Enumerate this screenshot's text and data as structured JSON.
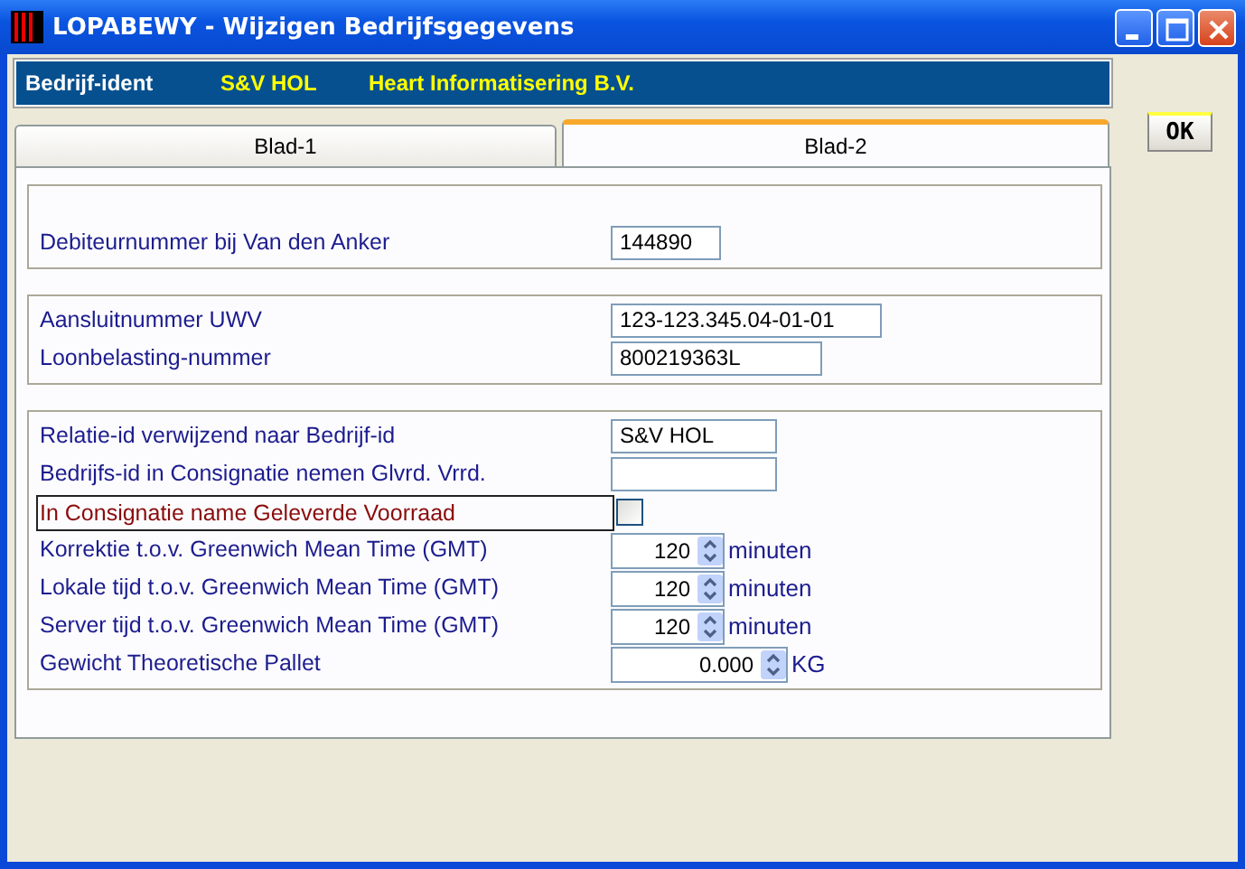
{
  "window": {
    "title": "LOPABEWY - Wijzigen Bedrijfsgegevens"
  },
  "header": {
    "label": "Bedrijf-ident",
    "code": "S&V HOL",
    "name": "Heart Informatisering B.V."
  },
  "tabs": [
    {
      "label": "Blad-1",
      "selected": false
    },
    {
      "label": "Blad-2",
      "selected": true
    }
  ],
  "ok_button": "OK",
  "groups": [
    {
      "rows": [
        {
          "kind": "blank"
        },
        {
          "kind": "text",
          "label": "Debiteurnummer bij Van den Anker",
          "value": "144890"
        }
      ]
    },
    {
      "rows": [
        {
          "kind": "text",
          "label": "Aansluitnummer UWV",
          "value": "123-123.345.04-01-01"
        },
        {
          "kind": "text",
          "label": "Loonbelasting-nummer",
          "value": "800219363L"
        }
      ]
    },
    {
      "rows": [
        {
          "kind": "text",
          "label": "Relatie-id verwijzend naar Bedrijf-id",
          "value": "S&V HOL"
        },
        {
          "kind": "text",
          "label": "Bedrijfs-id in Consignatie nemen Glvrd. Vrrd.",
          "value": ""
        },
        {
          "kind": "check",
          "label": "In Consignatie name Geleverde Voorraad",
          "checked": false
        },
        {
          "kind": "spin",
          "label": "Korrektie t.o.v. Greenwich Mean Time (GMT)",
          "value": "120",
          "unit": "minuten"
        },
        {
          "kind": "spin",
          "label": "Lokale tijd t.o.v. Greenwich Mean Time (GMT)",
          "value": "120",
          "unit": "minuten"
        },
        {
          "kind": "spin",
          "label": "Server tijd t.o.v. Greenwich Mean Time (GMT)",
          "value": "120",
          "unit": "minuten"
        },
        {
          "kind": "spin",
          "label": "Gewicht Theoretische Pallet",
          "value": "0.000",
          "unit": "KG"
        }
      ]
    }
  ]
}
